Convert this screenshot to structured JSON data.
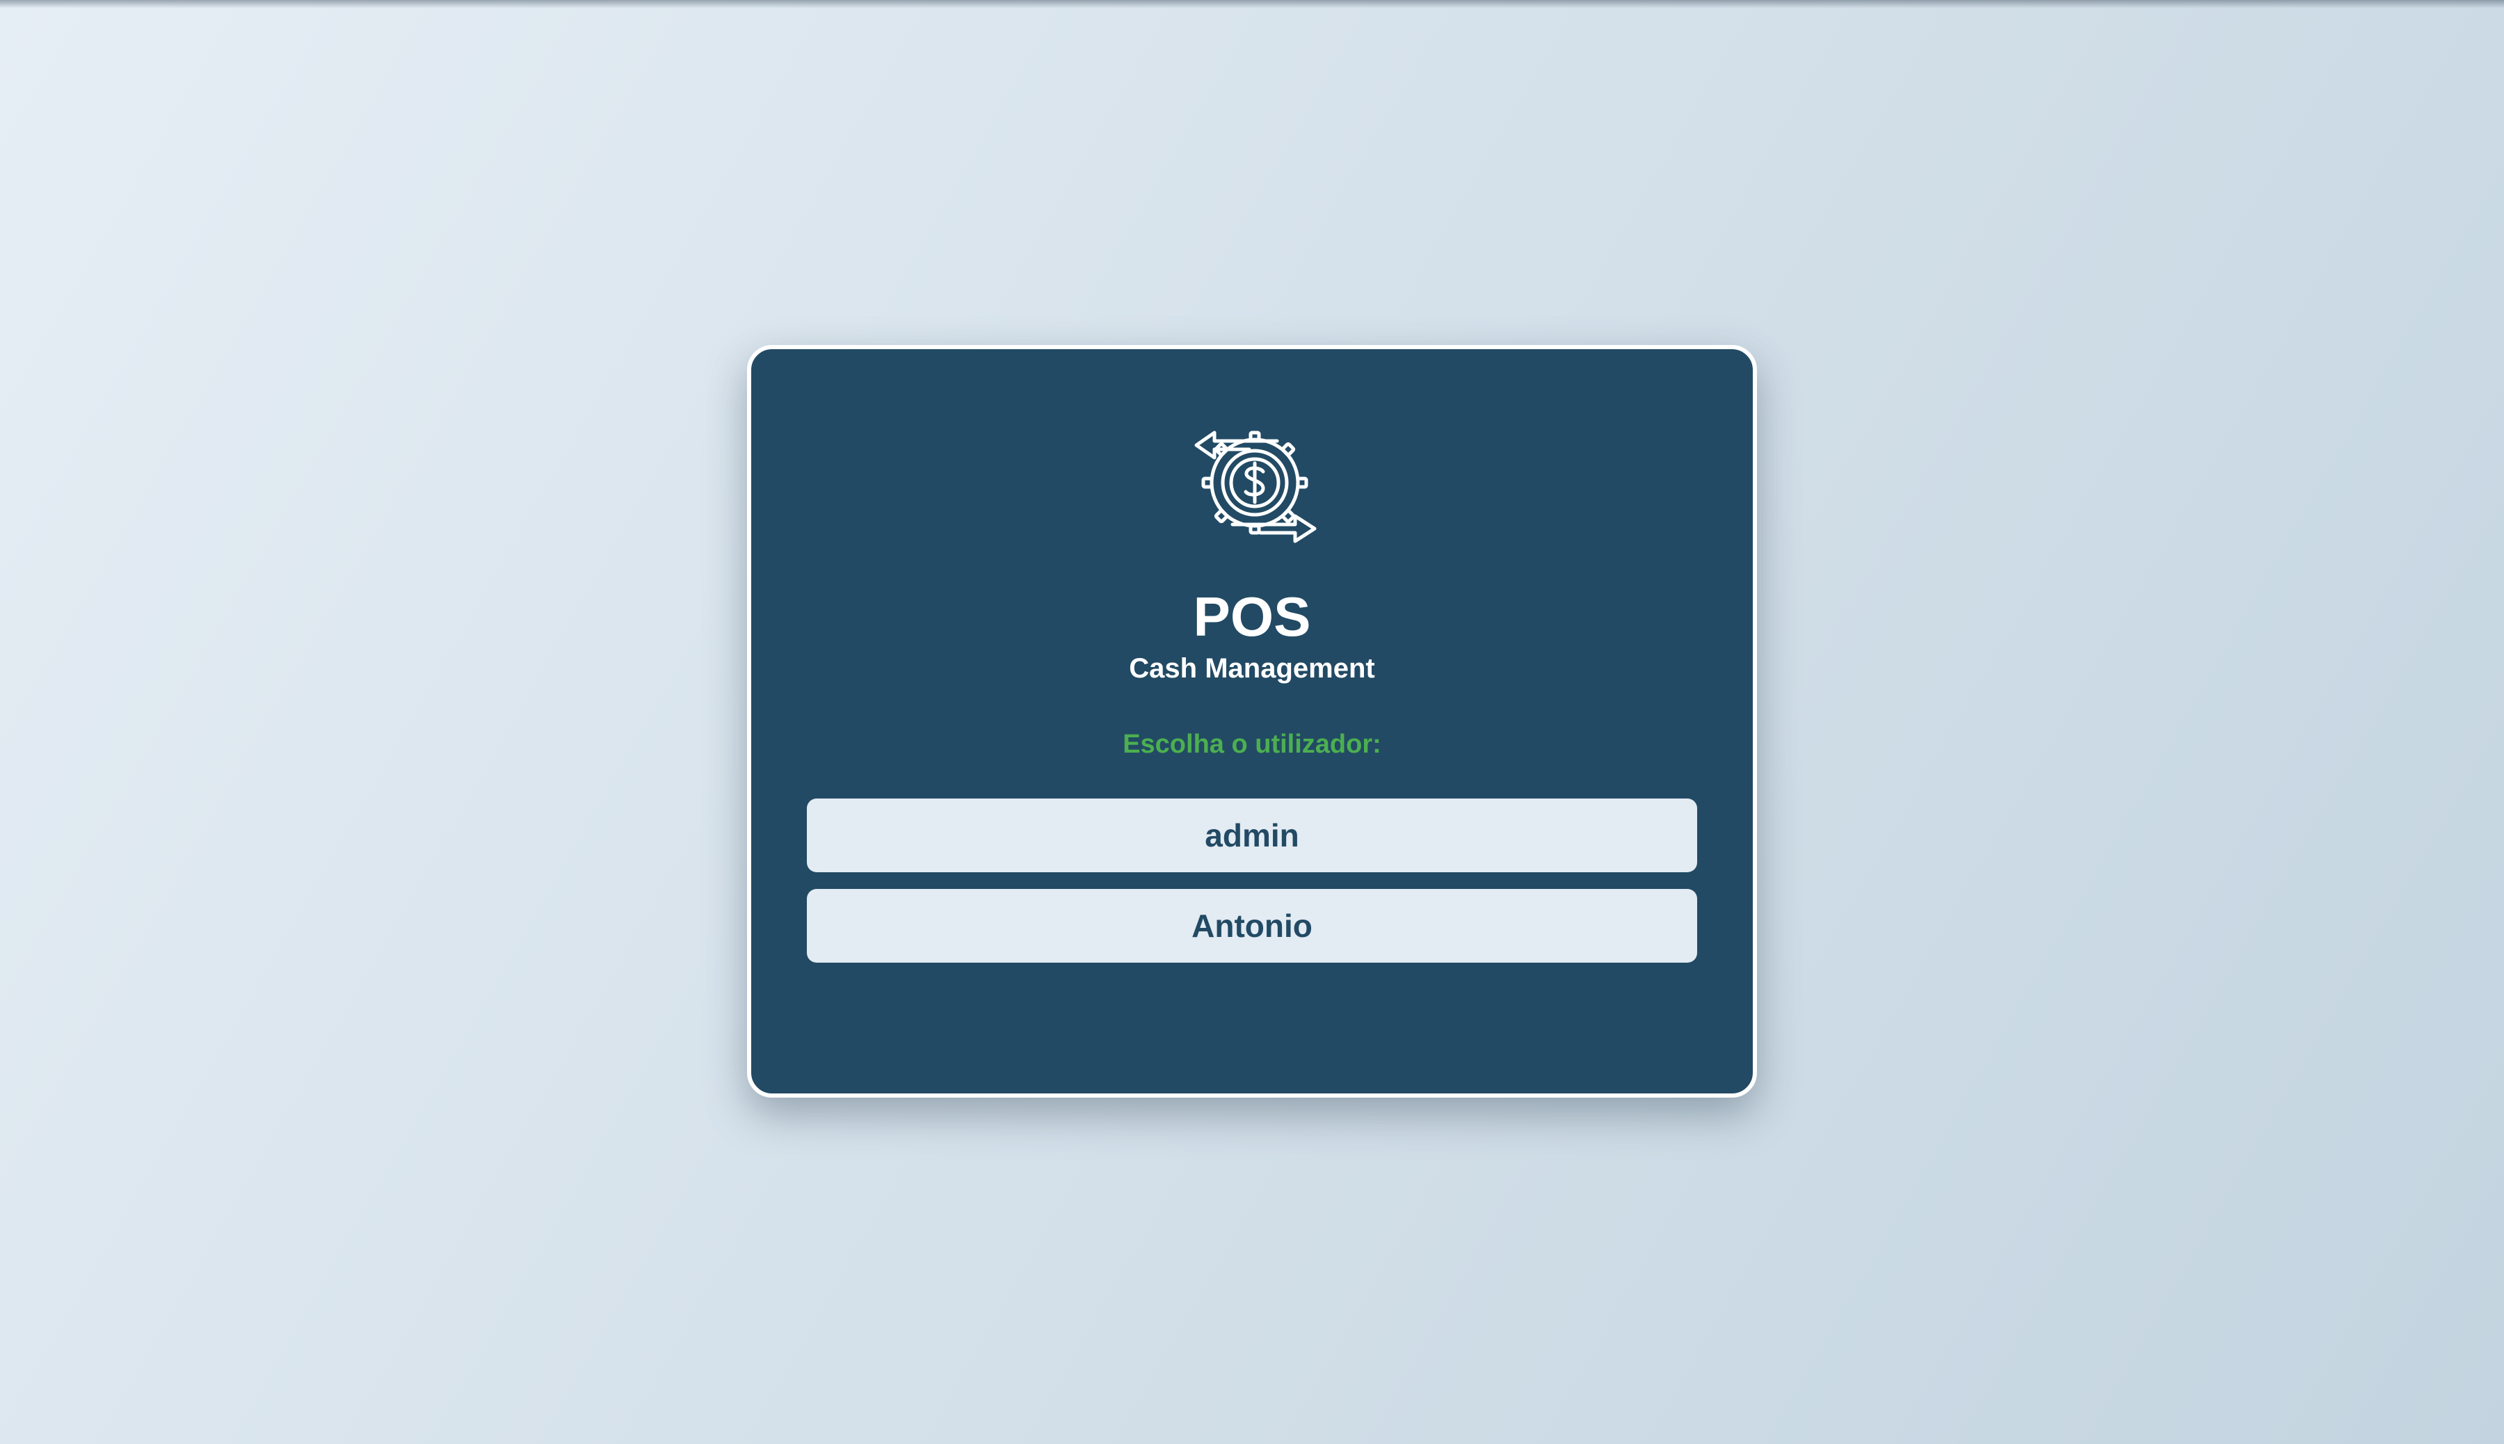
{
  "app": {
    "title": "POS",
    "subtitle": "Cash Management",
    "logo_icon": "cash-management-gear-dollar-icon"
  },
  "login": {
    "prompt": "Escolha o utilizador:",
    "users": [
      {
        "label": "admin"
      },
      {
        "label": "Antonio"
      }
    ]
  },
  "colors": {
    "card_background": "#224a64",
    "card_border": "#ffffff",
    "prompt_text": "#4caf50",
    "button_background": "#e3ebf3",
    "button_text": "#224a64"
  }
}
